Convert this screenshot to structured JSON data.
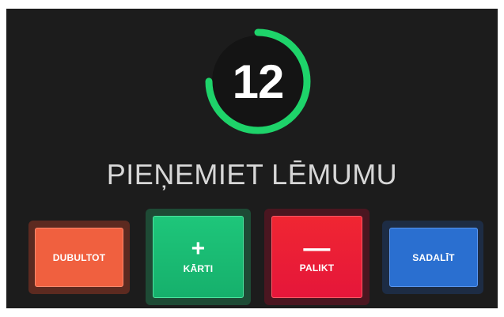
{
  "timer": {
    "value": "12",
    "remaining_fraction": 0.75,
    "ring_color": "#1ed36a",
    "track_color": "#1c1c1c"
  },
  "title": "PIEŅEMIET LĒMUMU",
  "buttons": {
    "double": {
      "label": "DUBULTOT",
      "color": "#f0603f"
    },
    "card": {
      "symbol": "+",
      "label": "KĀRTI",
      "color": "#1ec67a"
    },
    "stand": {
      "symbol": "—",
      "label": "PALIKT",
      "color": "#f02632"
    },
    "split": {
      "label": "SADALĪT",
      "color": "#2a6fd0"
    }
  }
}
